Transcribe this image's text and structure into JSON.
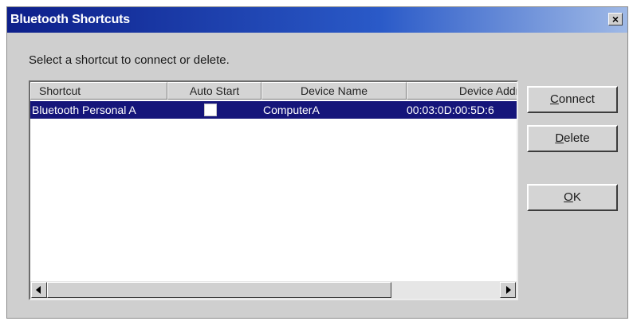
{
  "window": {
    "title": "Bluetooth Shortcuts",
    "close_glyph": "×"
  },
  "instruction": "Select a shortcut to connect or delete.",
  "list": {
    "columns": [
      "Shortcut",
      "Auto Start",
      "Device Name",
      "Device Addre:"
    ],
    "rows": [
      {
        "shortcut": "Bluetooth Personal A",
        "auto_start": false,
        "device_name": "ComputerA",
        "device_address": "00:03:0D:00:5D:6"
      }
    ],
    "selected_row": 0
  },
  "buttons": {
    "connect": {
      "accel": "C",
      "rest": "onnect"
    },
    "delete": {
      "accel": "D",
      "rest": "elete"
    },
    "ok": {
      "accel": "O",
      "rest": "K"
    }
  },
  "colors": {
    "title_start": "#0d1f8a",
    "selection": "#15157a",
    "dialog_bg": "#cfcfcf"
  },
  "icons": [
    "close-icon",
    "scroll-left-arrow-icon",
    "scroll-right-arrow-icon"
  ]
}
